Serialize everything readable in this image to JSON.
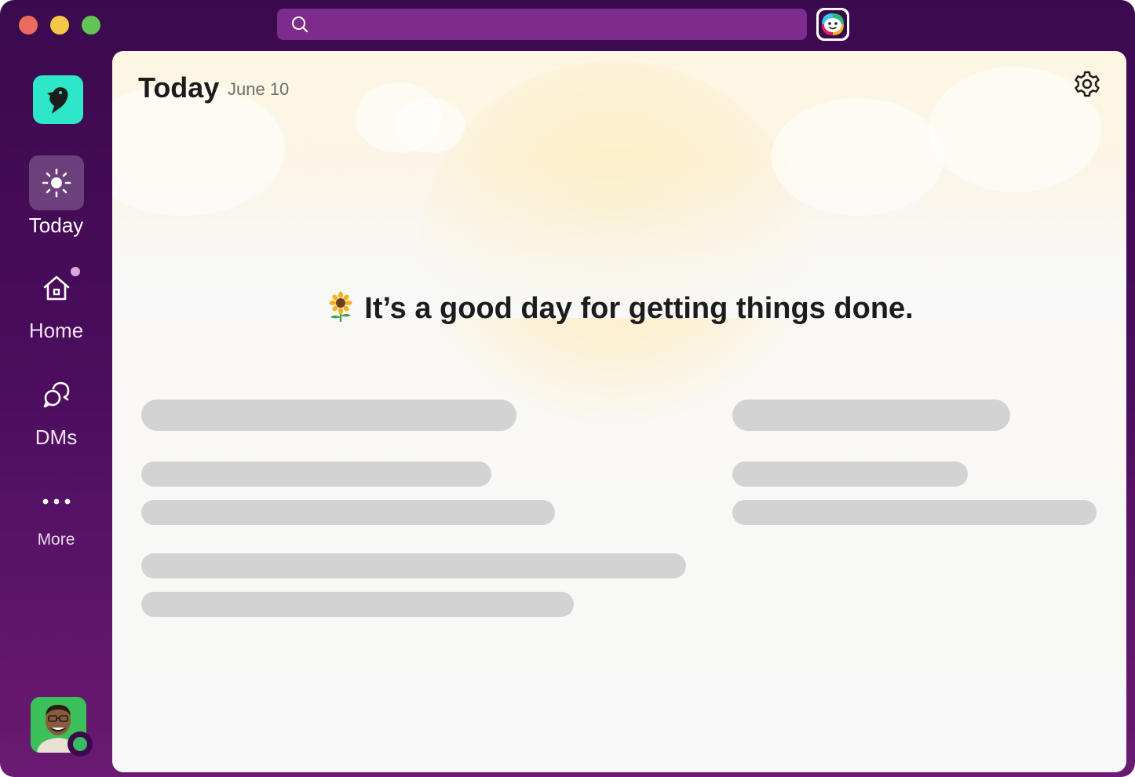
{
  "window": {
    "search": {
      "placeholder": ""
    }
  },
  "sidebar": {
    "items": [
      {
        "label": "Today",
        "icon": "sun-icon",
        "active": true
      },
      {
        "label": "Home",
        "icon": "home-icon",
        "has_badge": true
      },
      {
        "label": "DMs",
        "icon": "dm-bubbles-icon"
      },
      {
        "label": "More",
        "icon": "more-dots-icon"
      }
    ],
    "workspace_icon": "bird-logo-icon",
    "user_status": "online"
  },
  "main": {
    "title": "Today",
    "date": "June 10",
    "headline": "It’s a good day for getting things done.",
    "headline_icon": "sunflower-icon",
    "settings_icon": "gear-icon"
  },
  "colors": {
    "sidebar_bg": "#3b0a4e",
    "search_bg": "#7e2c8b",
    "logo_bg": "#2ee6c8",
    "skeleton": "#d3d3d3",
    "presence": "#3cb964"
  }
}
